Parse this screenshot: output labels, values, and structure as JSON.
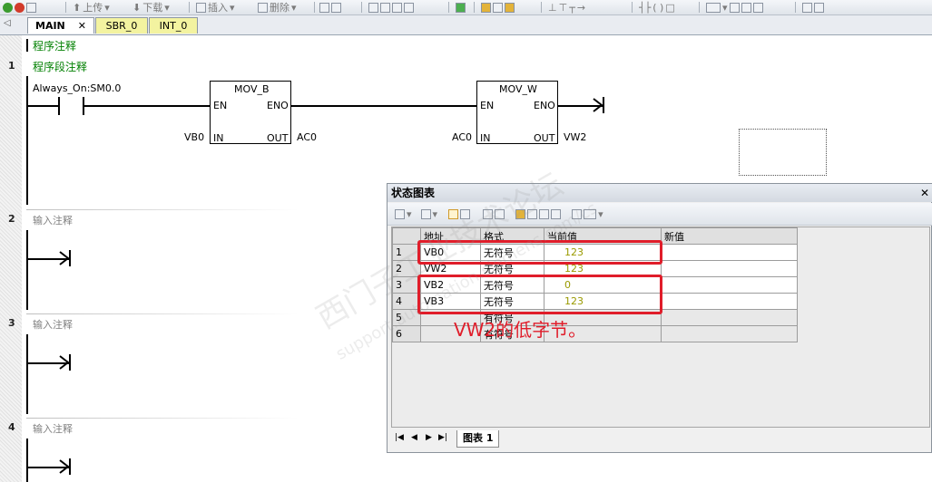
{
  "toolbar": {
    "upload": "上传",
    "download": "下载",
    "insert": "插入",
    "delete": "删除"
  },
  "tabs": [
    {
      "label": "MAIN"
    },
    {
      "label": "SBR_0"
    },
    {
      "label": "INT_0"
    }
  ],
  "program": {
    "program_comment": "程序注释",
    "networks": [
      {
        "number": "1",
        "comment": "程序段注释",
        "contact": "Always_On:SM0.0",
        "box1": {
          "title": "MOV_B",
          "en": "EN",
          "eno": "ENO",
          "in_label": "IN",
          "out_label": "OUT",
          "in_op": "VB0",
          "out_op": "AC0"
        },
        "box2": {
          "title": "MOV_W",
          "en": "EN",
          "eno": "ENO",
          "in_label": "IN",
          "out_label": "OUT",
          "in_op": "AC0",
          "out_op": "VW2"
        }
      },
      {
        "number": "2",
        "comment": "输入注释"
      },
      {
        "number": "3",
        "comment": "输入注释"
      },
      {
        "number": "4",
        "comment": "输入注释"
      }
    ]
  },
  "status_chart": {
    "title": "状态图表",
    "headers": {
      "address": "地址",
      "format": "格式",
      "current": "当前值",
      "new": "新值"
    },
    "rows": [
      {
        "n": "1",
        "address": "VB0",
        "format": "无符号",
        "current": "123",
        "new": ""
      },
      {
        "n": "2",
        "address": "VW2",
        "format": "无符号",
        "current": "123",
        "new": ""
      },
      {
        "n": "3",
        "address": "VB2",
        "format": "无符号",
        "current": "0",
        "new": ""
      },
      {
        "n": "4",
        "address": "VB3",
        "format": "无符号",
        "current": "123",
        "new": ""
      },
      {
        "n": "5",
        "address": "",
        "format": "有符号",
        "current": "",
        "new": ""
      },
      {
        "n": "6",
        "address": "",
        "format": "有符号",
        "current": "",
        "new": ""
      }
    ],
    "sheet_tab": "图表 1",
    "nav": [
      "|◀",
      "◀",
      "▶",
      "▶|"
    ]
  },
  "annotation": "VW2的低字节。",
  "watermark": {
    "cn": "西门子工业技术论坛",
    "url": "support.automation.siemens.com/cs"
  },
  "colors": {
    "comment_green": "#008000",
    "highlight_red": "#e01d2a",
    "value_olive": "#9a9a00"
  }
}
